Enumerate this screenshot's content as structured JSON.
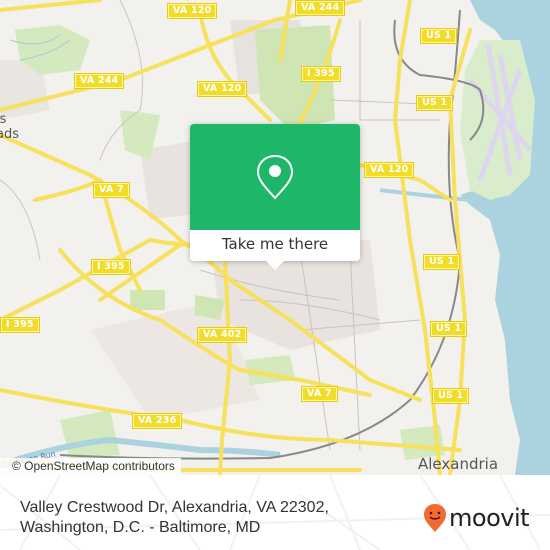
{
  "map": {
    "colors": {
      "land": "#f2f1ed",
      "road": "#f7e05a",
      "water": "#aad3df",
      "park": "#cde8b0",
      "rail": "#8a8a8a",
      "airport": "#e0dcf0"
    },
    "shields": [
      {
        "label": "VA 120",
        "name": "shield-va120-top"
      },
      {
        "label": "VA 244",
        "name": "shield-va244-top"
      },
      {
        "label": "US 1",
        "name": "shield-us1-top"
      },
      {
        "label": "VA 244",
        "name": "shield-va244-left"
      },
      {
        "label": "VA 120",
        "name": "shield-va120-mid"
      },
      {
        "label": "I 395",
        "name": "shield-i395-top"
      },
      {
        "label": "US 1",
        "name": "shield-us1-mid"
      },
      {
        "label": "VA 7",
        "name": "shield-va7-left"
      },
      {
        "label": "VA 120",
        "name": "shield-va120-right"
      },
      {
        "label": "I 395",
        "name": "shield-i395-mid"
      },
      {
        "label": "US 1",
        "name": "shield-us1-right1"
      },
      {
        "label": "I 395",
        "name": "shield-i395-left"
      },
      {
        "label": "VA 402",
        "name": "shield-va402"
      },
      {
        "label": "US 1",
        "name": "shield-us1-right2"
      },
      {
        "label": "VA 7",
        "name": "shield-va7-right"
      },
      {
        "label": "US 1",
        "name": "shield-us1-right3"
      },
      {
        "label": "VA 236",
        "name": "shield-va236"
      }
    ],
    "places": {
      "baileys": "'s\nads",
      "alexandria": "Alexandria",
      "stream": "Cameron Run"
    },
    "attribution": "© OpenStreetMap contributors"
  },
  "popup": {
    "icon": "map-pin-icon",
    "button_label": "Take me there",
    "accent": "#1eb76a"
  },
  "footer": {
    "address_line1": "Valley Crestwood Dr, Alexandria, VA 22302,",
    "address_line2": "Washington, D.C. - Baltimore, MD",
    "logo_text": "moovit",
    "logo_color": "#f26a32"
  }
}
